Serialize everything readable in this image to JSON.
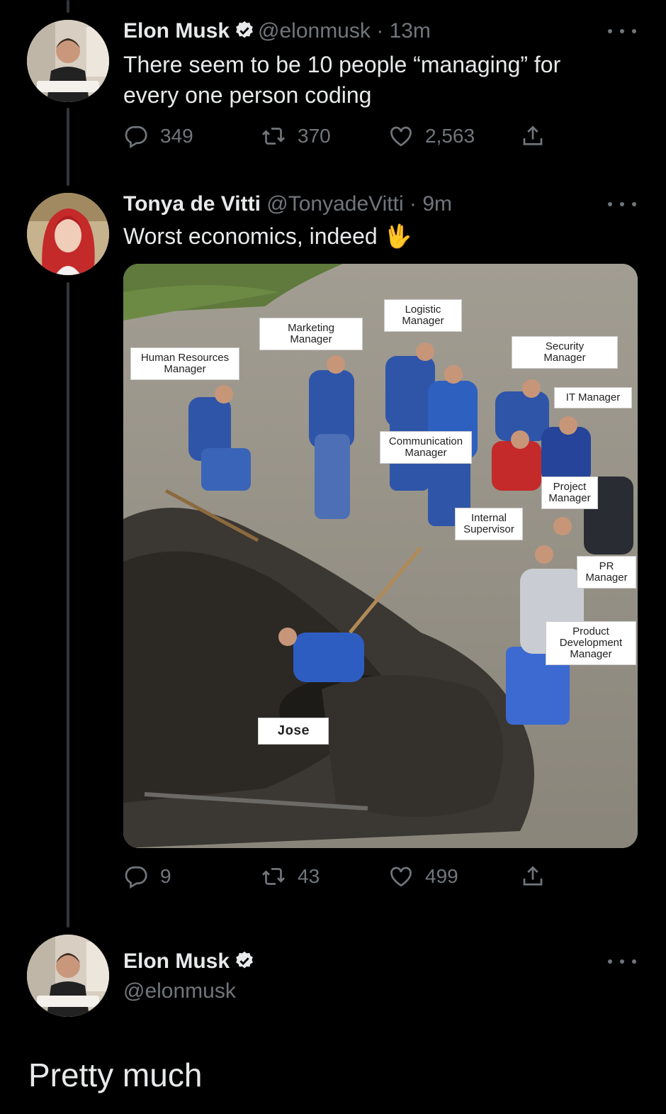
{
  "tweets": [
    {
      "name": "Elon Musk",
      "handle": "@elonmusk",
      "dot": "·",
      "time": "13m",
      "text_line1": "There seem to be 10 people “managing” for",
      "text_line2": "every one person coding",
      "replies": "349",
      "retweets": "370",
      "likes": "2,563"
    },
    {
      "name": "Tonya de Vitti",
      "handle": "@TonyadeVitti",
      "dot": "·",
      "time": "9m",
      "text": "Worst economics, indeed",
      "emoji": "🖖",
      "replies": "9",
      "retweets": "43",
      "likes": "499",
      "image_labels": {
        "hr": "Human Resources\nManager",
        "marketing": "Marketing\nManager",
        "logistic": "Logistic\nManager",
        "security": "Security\nManager",
        "it": "IT Manager",
        "communication": "Communication\nManager",
        "project": "Project\nManager",
        "internal": "Internal\nSupervisor",
        "pr": "PR\nManager",
        "product": "Product\nDevelopment\nManager",
        "jose": "Jose"
      }
    },
    {
      "name": "Elon Musk",
      "handle": "@elonmusk",
      "text": "Pretty much"
    }
  ],
  "icons": {
    "verified": "verified-badge-icon",
    "reply": "reply-icon",
    "retweet": "retweet-icon",
    "like": "heart-icon",
    "share": "share-icon",
    "more": "more-icon"
  },
  "colors": {
    "background": "#000000",
    "text": "#e7e9ea",
    "secondary": "#71767b",
    "thread_line": "#333639"
  }
}
